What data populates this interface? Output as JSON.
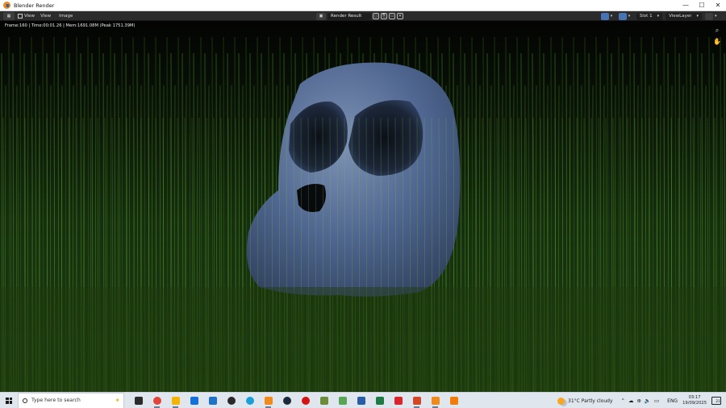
{
  "window": {
    "title": "Blender Render",
    "controls": {
      "minimize": "—",
      "maximize": "☐",
      "close": "✕"
    }
  },
  "header": {
    "menus": [
      "View",
      "View",
      "Image"
    ],
    "image_name": "Render Result",
    "slot": "Slot 1",
    "layer": "ViewLayer"
  },
  "render": {
    "info": "Frame:160 | Time:00:01.26 | Mem:1691.08M (Peak 1751.39M)"
  },
  "taskbar": {
    "search_placeholder": "Type here to search",
    "apps": [
      {
        "name": "task-view-icon",
        "color": "#2b2b2b"
      },
      {
        "name": "chrome-icon",
        "color": "#e0463a"
      },
      {
        "name": "file-explorer-icon",
        "color": "#f4b400"
      },
      {
        "name": "mail-icon",
        "color": "#1570d8"
      },
      {
        "name": "store-icon",
        "color": "#1e73c8"
      },
      {
        "name": "obs-icon",
        "color": "#2a2a2a"
      },
      {
        "name": "edge-icon",
        "color": "#1a9fd8"
      },
      {
        "name": "blender-icon",
        "color": "#f08a1c"
      },
      {
        "name": "steam-icon",
        "color": "#1b2838"
      },
      {
        "name": "record-icon",
        "color": "#d21414"
      },
      {
        "name": "minecraft-icon",
        "color": "#6a8d3a"
      },
      {
        "name": "notepad-icon",
        "color": "#5aa45a"
      },
      {
        "name": "word-icon",
        "color": "#2b5ca8"
      },
      {
        "name": "excel-icon",
        "color": "#1f7a45"
      },
      {
        "name": "acrobat-icon",
        "color": "#d9262c"
      },
      {
        "name": "powerpoint-icon",
        "color": "#d24726"
      },
      {
        "name": "blender-open-icon",
        "color": "#f08a1c"
      },
      {
        "name": "vlc-icon",
        "color": "#f07d0a"
      }
    ],
    "weather": "31°C  Partly cloudy",
    "language": "ENG",
    "time": "03:17",
    "date": "19/09/2025",
    "notifications": "21"
  }
}
